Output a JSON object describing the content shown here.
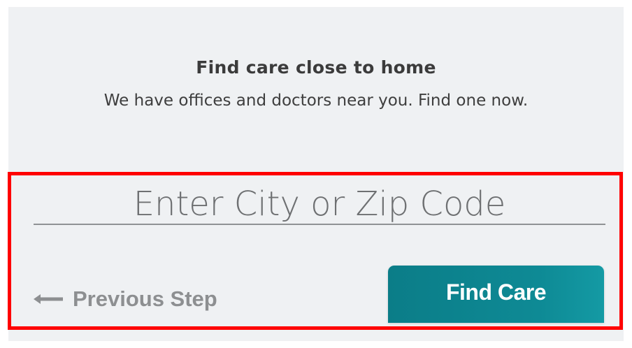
{
  "header": {
    "title": "Find care close to home",
    "subtitle": "We have offices and doctors near you. Find one now."
  },
  "search": {
    "placeholder": "Enter City or Zip Code",
    "value": ""
  },
  "actions": {
    "previous_label": "Previous Step",
    "previous_icon": "arrow-left-icon",
    "submit_label": "Find Care"
  },
  "colors": {
    "panel_bg": "#eff1f3",
    "accent": "#0e8a95",
    "highlight": "#ff0000",
    "muted_text": "#8d8f91"
  }
}
